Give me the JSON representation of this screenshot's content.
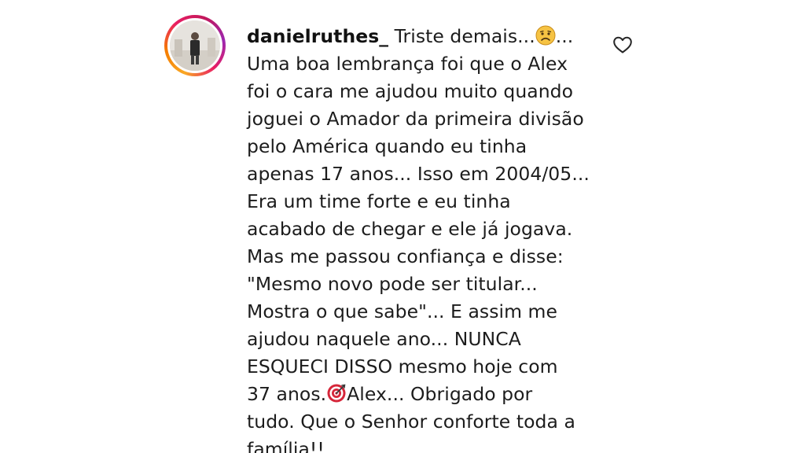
{
  "comment": {
    "username": "danielruthes_",
    "avatar_icon": "profile-photo",
    "ring_colors": [
      "#f9a825",
      "#e91e63",
      "#9c27b0"
    ],
    "lines": [
      {
        "before": " Triste demais...",
        "emoji": "sad-face-emoji",
        "after": "..."
      },
      {
        "text": "Uma boa lembrança foi que o Alex"
      },
      {
        "text": "foi o cara me ajudou muito quando"
      },
      {
        "text": "joguei o Amador da primeira divisão"
      },
      {
        "text": "pelo América quando eu tinha"
      },
      {
        "text": "apenas 17 anos... Isso em 2004/05..."
      },
      {
        "text": "Era um time forte e eu tinha"
      },
      {
        "text": "acabado de chegar e ele já jogava."
      },
      {
        "text": "Mas me passou confiança e disse:"
      },
      {
        "text": "\"Mesmo novo pode ser titular..."
      },
      {
        "text": "Mostra o que sabe\"... E assim me"
      },
      {
        "text": "ajudou naquele ano... NUNCA"
      },
      {
        "text": "ESQUECI DISSO mesmo hoje com"
      },
      {
        "before": "37 anos.",
        "emoji": "target-emoji",
        "after": "Alex... Obrigado por"
      },
      {
        "text": "tudo. Que o Senhor conforte toda a"
      },
      {
        "text": "família!!"
      }
    ],
    "like_icon": "heart-outline-icon"
  }
}
